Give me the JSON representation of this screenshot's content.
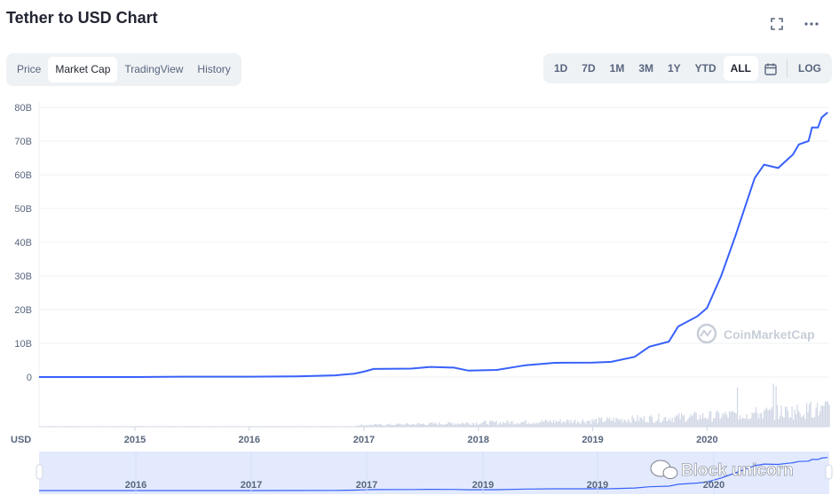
{
  "header": {
    "title": "Tether to USD Chart",
    "fullscreen_icon": "expand-icon",
    "more_icon": "more-horizontal-icon"
  },
  "tabs": [
    {
      "label": "Price",
      "active": false
    },
    {
      "label": "Market Cap",
      "active": true
    },
    {
      "label": "TradingView",
      "active": false
    },
    {
      "label": "History",
      "active": false
    }
  ],
  "ranges": [
    {
      "label": "1D",
      "active": false
    },
    {
      "label": "7D",
      "active": false
    },
    {
      "label": "1M",
      "active": false
    },
    {
      "label": "3M",
      "active": false
    },
    {
      "label": "1Y",
      "active": false
    },
    {
      "label": "YTD",
      "active": false
    },
    {
      "label": "ALL",
      "active": true
    }
  ],
  "calendar_icon": "calendar-icon",
  "log_label": "LOG",
  "watermark": "CoinMarketCap",
  "overlay_watermark": "Block unicorn",
  "colors": {
    "line": "#3861fb",
    "volume": "#cfd6e4",
    "grid": "#eff2f5",
    "navigator_fill": "#e3eafd"
  },
  "chart_data": {
    "type": "line",
    "currency_label": "USD",
    "y_unit": "B (USD)",
    "ylim": [
      0,
      80
    ],
    "y_ticks": [
      "80B",
      "70B",
      "60B",
      "50B",
      "40B",
      "30B",
      "20B",
      "10B",
      "0"
    ],
    "x_ticks": [
      "2015",
      "2016",
      "2017",
      "2018",
      "2019",
      "2020"
    ],
    "navigator_ticks": [
      "2016",
      "2017",
      "2017",
      "2019",
      "2019",
      "2020"
    ],
    "series": [
      {
        "values": [
          {
            "x": "2014-03-01",
            "y": 0.0
          },
          {
            "x": "2015-01-01",
            "y": 0.0
          },
          {
            "x": "2015-06-01",
            "y": 0.1
          },
          {
            "x": "2016-01-01",
            "y": 0.1
          },
          {
            "x": "2016-06-01",
            "y": 0.2
          },
          {
            "x": "2016-10-01",
            "y": 0.5
          },
          {
            "x": "2016-12-01",
            "y": 1.0
          },
          {
            "x": "2017-01-01",
            "y": 1.6
          },
          {
            "x": "2017-02-01",
            "y": 2.4
          },
          {
            "x": "2017-06-01",
            "y": 2.5
          },
          {
            "x": "2017-08-01",
            "y": 3.0
          },
          {
            "x": "2017-10-15",
            "y": 2.8
          },
          {
            "x": "2017-12-01",
            "y": 1.9
          },
          {
            "x": "2018-03-01",
            "y": 2.1
          },
          {
            "x": "2018-06-01",
            "y": 3.5
          },
          {
            "x": "2018-09-01",
            "y": 4.2
          },
          {
            "x": "2019-01-01",
            "y": 4.3
          },
          {
            "x": "2019-03-01",
            "y": 4.5
          },
          {
            "x": "2019-05-15",
            "y": 6.0
          },
          {
            "x": "2019-07-01",
            "y": 9.0
          },
          {
            "x": "2019-09-01",
            "y": 10.5
          },
          {
            "x": "2019-10-01",
            "y": 15.0
          },
          {
            "x": "2019-12-01",
            "y": 18.0
          },
          {
            "x": "2020-01-01",
            "y": 20.5
          },
          {
            "x": "2020-02-15",
            "y": 30.0
          },
          {
            "x": "2020-04-01",
            "y": 42.0
          },
          {
            "x": "2020-06-01",
            "y": 59.0
          },
          {
            "x": "2020-07-01",
            "y": 63.0
          },
          {
            "x": "2020-08-15",
            "y": 62.0
          },
          {
            "x": "2020-10-01",
            "y": 66.0
          },
          {
            "x": "2020-10-20",
            "y": 69.0
          },
          {
            "x": "2020-11-20",
            "y": 70.0
          },
          {
            "x": "2020-12-01",
            "y": 74.0
          },
          {
            "x": "2020-12-20",
            "y": 74.0
          },
          {
            "x": "2021-01-01",
            "y": 77.0
          },
          {
            "x": "2021-01-20",
            "y": 78.5
          }
        ]
      }
    ],
    "grid": true,
    "log_scale": false
  }
}
